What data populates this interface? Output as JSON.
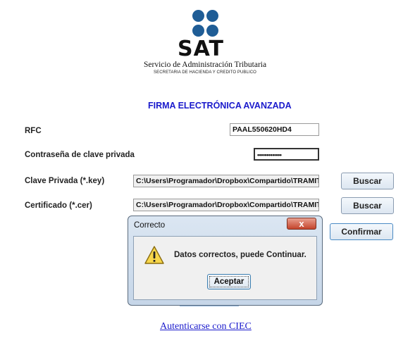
{
  "logo": {
    "wordmark": "SAT",
    "line1": "Servicio de Administración Tributaria",
    "line2": "SECRETARIA DE HACIENDA Y CREDITO PUBLICO",
    "dot_color": "#1f5d96"
  },
  "form": {
    "title": "FIRMA ELECTRÓNICA AVANZADA",
    "rfc_label": "RFC",
    "rfc_value": "PAAL550620HD4",
    "password_label": "Contraseña de clave privada",
    "password_value": "•••••••••••••",
    "key_label": "Clave Privada (*.key)",
    "key_value": "C:\\Users\\Programador\\Dropbox\\Compartido\\TRAMITE",
    "cert_label": "Certificado (*.cer)",
    "cert_value": "C:\\Users\\Programador\\Dropbox\\Compartido\\TRAMITE",
    "buscar_label": "Buscar",
    "confirm_label": "Confirmar"
  },
  "dialog": {
    "title": "Correcto",
    "close_glyph": "x",
    "message": "Datos correctos, puede Continuar.",
    "ok_label": "Aceptar",
    "icon": "warning-icon"
  },
  "ciec_link": "Autenticarse con CIEC",
  "colors": {
    "title_blue": "#1a1acc",
    "link_blue": "#1a1acc"
  }
}
